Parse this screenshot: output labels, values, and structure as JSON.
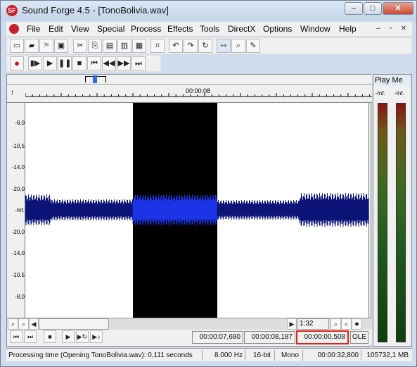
{
  "window": {
    "title": "Sound Forge 4.5 - [TonoBolivia.wav]",
    "min": "‒",
    "max": "□",
    "close": "✕"
  },
  "menu": [
    "File",
    "Edit",
    "View",
    "Special",
    "Process",
    "Effects",
    "Tools",
    "DirectX",
    "Options",
    "Window",
    "Help"
  ],
  "mdi": {
    "min": "–",
    "restore": "▫",
    "close": "✕"
  },
  "toolbar1": [
    "new",
    "open",
    "x",
    "save",
    "cut",
    "copy",
    "paste",
    "paste-special",
    "mix",
    "crop",
    "undo",
    "redo",
    "repeat",
    "edit-tool",
    "magnify-tool",
    "pencil-tool"
  ],
  "toolbar2": [
    "record",
    "play-all",
    "play",
    "pause",
    "stop",
    "go-start",
    "rewind",
    "fast-forward",
    "go-end"
  ],
  "ruler": {
    "label": "00:00:08"
  },
  "yaxis": {
    "labels": [
      "-8,0",
      "-10,5",
      "-14,0",
      "-20,0",
      "-Inf.",
      "-20,0",
      "-14,0",
      "-10,5",
      "-8,0"
    ]
  },
  "zoom": {
    "ratio": "1:32"
  },
  "selection": {
    "start": "00:00:07,680",
    "end": "00:00:08,187",
    "length": "00:00:00,508",
    "ole": "OLE"
  },
  "status": {
    "message": "Processing time (Opening TonoBolivia.wav): 0,111 seconds",
    "rate": "8.000 Hz",
    "bits": "16-bit",
    "channels": "Mono",
    "duration": "00:00:32,800",
    "free": "105732,1 MB"
  },
  "playmeter": {
    "title": "Play Me",
    "left": "-Inf.",
    "right": "-Inf."
  },
  "colors": {
    "wave": "#0c1478",
    "wave_sel": "#1a34e6",
    "selection": "#000000",
    "highlight_box": "#e0201a"
  }
}
